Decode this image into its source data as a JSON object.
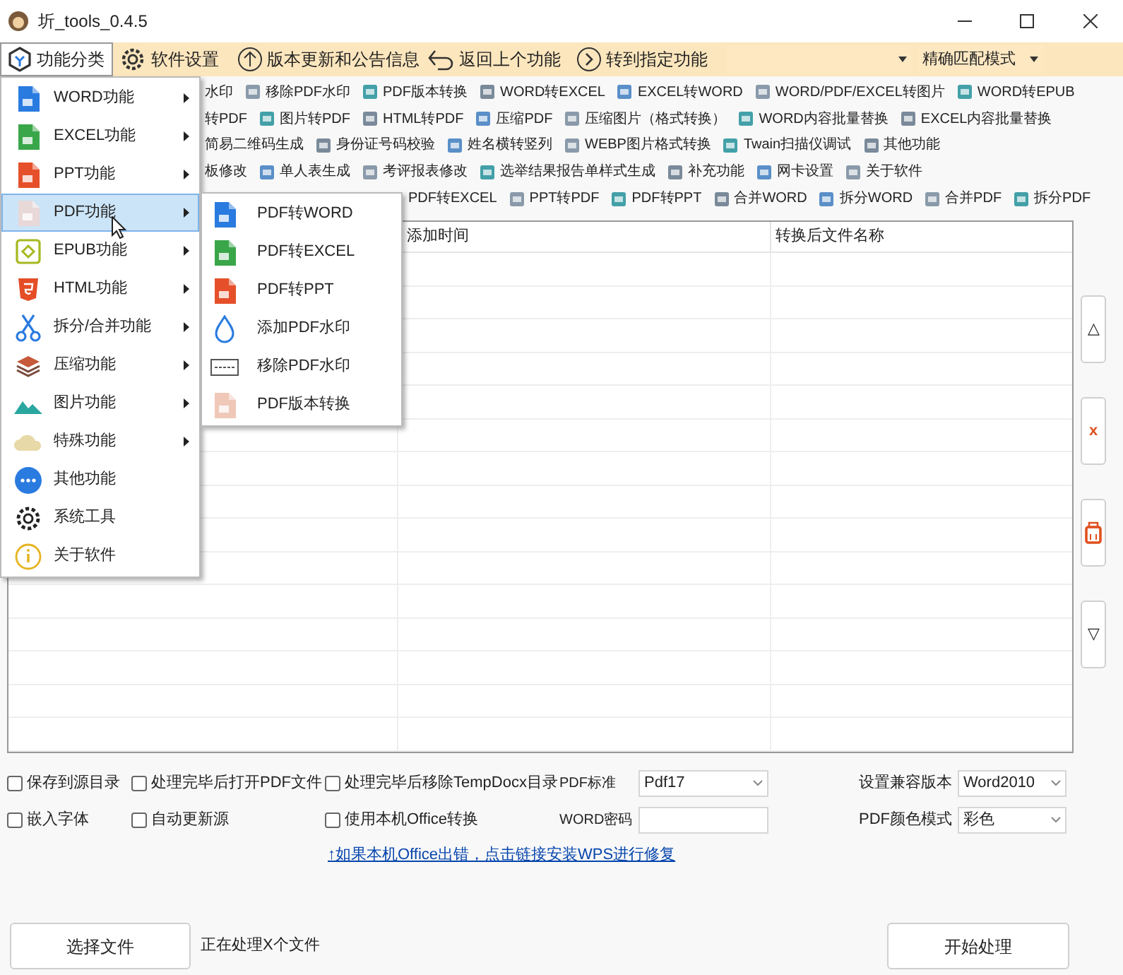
{
  "window": {
    "title": "圻_tools_0.4.5"
  },
  "toolbar": [
    {
      "label": "功能分类",
      "selected": true
    },
    {
      "label": "软件设置",
      "selected": false
    },
    {
      "label": "版本更新和公告信息",
      "selected": false
    },
    {
      "label": "返回上个功能",
      "selected": false
    },
    {
      "label": "转到指定功能",
      "selected": false
    }
  ],
  "match_mode": {
    "value": "精确匹配模式"
  },
  "quick_rows": [
    {
      "items": [
        "水印",
        "移除PDF水印",
        "PDF版本转换",
        "WORD转EXCEL",
        "EXCEL转WORD",
        "WORD/PDF/EXCEL转图片",
        "WORD转EPUB"
      ]
    },
    {
      "items": [
        "转PDF",
        "图片转PDF",
        "HTML转PDF",
        "压缩PDF",
        "压缩图片（格式转换）",
        "WORD内容批量替换",
        "EXCEL内容批量替换"
      ]
    },
    {
      "items": [
        "简易二维码生成",
        "身份证号码校验",
        "姓名横转竖列",
        "WEBP图片格式转换",
        "Twain扫描仪调试",
        "其他功能"
      ]
    },
    {
      "items": [
        "板修改",
        "单人表生成",
        "考评报表修改",
        "选举结果报告单样式生成",
        "补充功能",
        "网卡设置",
        "关于软件"
      ]
    },
    {
      "items": [
        "PDF转EXCEL",
        "PPT转PDF",
        "PDF转PPT",
        "合并WORD",
        "拆分WORD",
        "合并PDF",
        "拆分PDF"
      ]
    }
  ],
  "table": {
    "columns": [
      "添加时间",
      "转换后文件名称"
    ]
  },
  "side_buttons": [
    {
      "label": "△"
    },
    {
      "label": "x"
    },
    {
      "kind": "trash"
    },
    {
      "label": "▽"
    }
  ],
  "options": {
    "checkboxes_row_1": [
      {
        "label": "保存到源目录",
        "checked": false
      },
      {
        "label": "处理完毕后打开PDF文件",
        "checked": false
      },
      {
        "label": "处理完毕后移除TempDocx目录",
        "checked": false
      }
    ],
    "pdf_standard": {
      "label": "PDF标准",
      "value": "Pdf17"
    },
    "compat_version": {
      "label": "设置兼容版本",
      "value": "Word2010"
    },
    "checkboxes_row_2": [
      {
        "label": "嵌入字体",
        "checked": false
      },
      {
        "label": "自动更新源",
        "checked": false
      },
      {
        "label": "使用本机Office转换",
        "checked": false
      }
    ],
    "word_password": {
      "label": "WORD密码"
    },
    "pdf_color_mode": {
      "label": "PDF颜色模式",
      "value": "彩色"
    },
    "help_link": "↑如果本机Office出错，点击链接安装WPS进行修复"
  },
  "footer": {
    "select_button": "选择文件",
    "status": "正在处理X个文件",
    "start_button": "开始处理"
  },
  "menu": {
    "items": [
      {
        "label": "WORD功能",
        "has_submenu": true,
        "selected": false
      },
      {
        "label": "EXCEL功能",
        "has_submenu": true,
        "selected": false
      },
      {
        "label": "PPT功能",
        "has_submenu": true,
        "selected": false
      },
      {
        "label": "PDF功能",
        "has_submenu": true,
        "selected": true
      },
      {
        "label": "EPUB功能",
        "has_submenu": true,
        "selected": false
      },
      {
        "label": "HTML功能",
        "has_submenu": true,
        "selected": false
      },
      {
        "label": "拆分/合并功能",
        "has_submenu": true,
        "selected": false
      },
      {
        "label": "压缩功能",
        "has_submenu": true,
        "selected": false
      },
      {
        "label": "图片功能",
        "has_submenu": true,
        "selected": false
      },
      {
        "label": "特殊功能",
        "has_submenu": true,
        "selected": false
      },
      {
        "label": "其他功能",
        "has_submenu": false,
        "selected": false
      },
      {
        "label": "系统工具",
        "has_submenu": false,
        "selected": false
      },
      {
        "label": "关于软件",
        "has_submenu": false,
        "selected": false
      }
    ]
  },
  "submenu": {
    "items": [
      "PDF转WORD",
      "PDF转EXCEL",
      "PDF转PPT",
      "添加PDF水印",
      "移除PDF水印",
      "PDF版本转换"
    ]
  }
}
